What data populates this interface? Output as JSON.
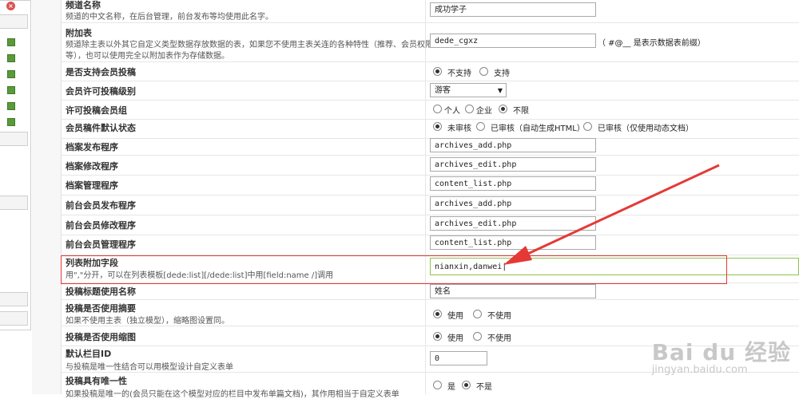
{
  "sidebar": {
    "close_icon": "close-icon",
    "item_icon": "tree-node-icon"
  },
  "rows": {
    "channel_name": {
      "label": "频道名称",
      "desc": "频道的中文名称，在后台管理，前台发布等均使用此名字。",
      "value": "成功学子"
    },
    "addon_table": {
      "label": "附加表",
      "desc1": "频道除主表以外其它自定义类型数据存放数据的表，如果您不使用主表关连的各种特性（推荐、会员权限",
      "desc2": "等），也可以使用完全以附加表作为存储数据。",
      "value": "dede_cgxz",
      "note": "（ #@__ 是表示数据表前缀）"
    },
    "member_submit": {
      "label": "是否支持会员投稿",
      "opt1": "不支持",
      "opt2": "支持"
    },
    "member_level": {
      "label": "会员许可投稿级别",
      "value": "游客"
    },
    "member_group": {
      "label": "许可投稿会员组",
      "opt1": "个人",
      "opt2": "企业",
      "opt3": "不限"
    },
    "default_status": {
      "label": "会员稿件默认状态",
      "opt1": "未审核",
      "opt2": "已审核（自动生成HTML）",
      "opt3": "已审核（仅使用动态文档）"
    },
    "archive_add": {
      "label": "档案发布程序",
      "value": "archives_add.php"
    },
    "archive_edit": {
      "label": "档案修改程序",
      "value": "archives_edit.php"
    },
    "archive_manage": {
      "label": "档案管理程序",
      "value": "content_list.php"
    },
    "front_add": {
      "label": "前台会员发布程序",
      "value": "archives_add.php"
    },
    "front_edit": {
      "label": "前台会员修改程序",
      "value": "archives_edit.php"
    },
    "front_manage": {
      "label": "前台会员管理程序",
      "value": "content_list.php"
    },
    "list_fields": {
      "label": "列表附加字段",
      "desc": "用\",\"分开，可以在列表模板[dede:list][/dede:list]中用[field:name /]调用",
      "value": "nianxin,danwei|"
    },
    "title_name": {
      "label": "投稿标题使用名称",
      "value": "姓名"
    },
    "use_summary": {
      "label": "投稿是否使用摘要",
      "desc": "如果不使用主表（独立模型），缩略图设置同。",
      "opt1": "使用",
      "opt2": "不使用"
    },
    "use_thumb": {
      "label": "投稿是否使用缩图",
      "opt1": "使用",
      "opt2": "不使用"
    },
    "default_col": {
      "label": "默认栏目ID",
      "desc": "与投稿是唯一性结合可以用模型设计自定义表单",
      "value": "0"
    },
    "unique": {
      "label": "投稿具有唯一性",
      "desc": "如果投稿是唯一的(会员只能在这个模型对应的栏目中发布单篇文档)，其作用相当于自定义表单",
      "opt1": "是",
      "opt2": "不是"
    }
  },
  "watermark": {
    "big": "Bai du 经验",
    "small": "jingyan.baidu.com"
  },
  "colors": {
    "highlight": "#e53935",
    "arrow": "#e53935",
    "focus": "#8fc44f"
  }
}
